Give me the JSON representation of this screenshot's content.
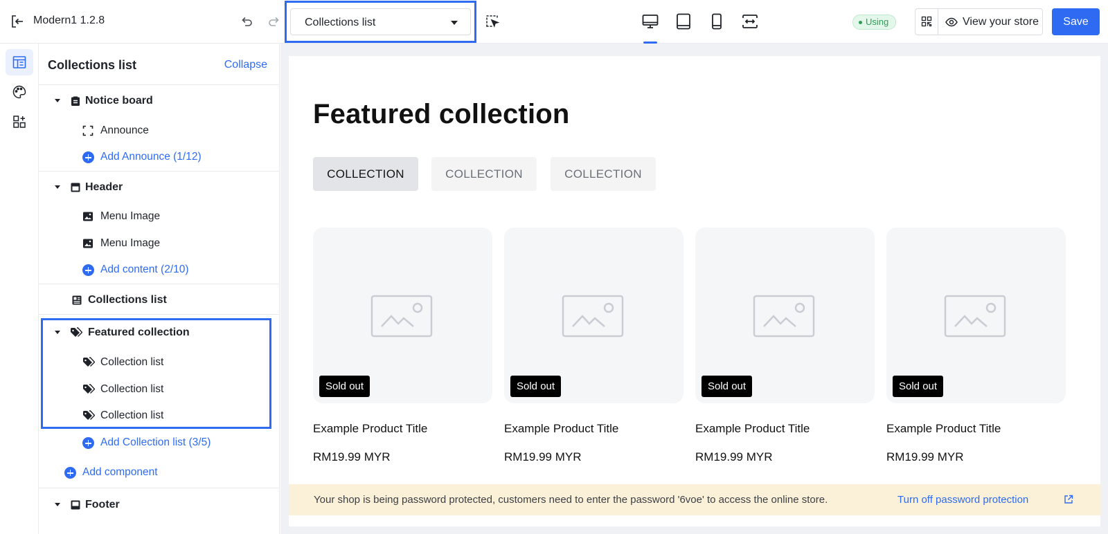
{
  "topbar": {
    "app_title": "Modern1 1.2.8",
    "page_select": "Collections list",
    "devices": [
      "desktop-icon",
      "tablet-icon",
      "mobile-icon",
      "fit-width-icon"
    ],
    "status_badge": "Using",
    "view_store_label": "View your store",
    "save_label": "Save"
  },
  "rail": {
    "items": [
      "layout-icon",
      "palette-icon",
      "add-widget-icon"
    ],
    "active": 0
  },
  "panel": {
    "title": "Collections list",
    "collapse_label": "Collapse",
    "sections": {
      "notice_board": {
        "label": "Notice board",
        "children": [
          "Announce"
        ],
        "add_label": "Add Announce (1/12)"
      },
      "header": {
        "label": "Header",
        "children": [
          "Menu Image",
          "Menu Image"
        ],
        "add_label": "Add content (2/10)"
      },
      "collections_list": {
        "label": "Collections list"
      },
      "featured_collection": {
        "label": "Featured collection",
        "children": [
          "Collection list",
          "Collection list",
          "Collection list"
        ],
        "add_label": "Add Collection list (3/5)"
      },
      "add_component_label": "Add component",
      "footer": {
        "label": "Footer"
      }
    }
  },
  "preview": {
    "heading": "Featured collection",
    "tabs": [
      "COLLECTION",
      "COLLECTION",
      "COLLECTION"
    ],
    "active_tab": 0,
    "products": [
      {
        "badge": "Sold out",
        "title": "Example Product Title",
        "price": "RM19.99 MYR"
      },
      {
        "badge": "Sold out",
        "title": "Example Product Title",
        "price": "RM19.99 MYR"
      },
      {
        "badge": "Sold out",
        "title": "Example Product Title",
        "price": "RM19.99 MYR"
      },
      {
        "badge": "Sold out",
        "title": "Example Product Title",
        "price": "RM19.99 MYR"
      }
    ]
  },
  "notice": {
    "text": "Your shop is being password protected, customers need to enter the password '6voe' to access the online store.",
    "link": "Turn off password protection"
  },
  "colors": {
    "accent": "#2e6bf2",
    "badge_green": "#2f9c57",
    "notice_bg": "#fbf0d8"
  }
}
